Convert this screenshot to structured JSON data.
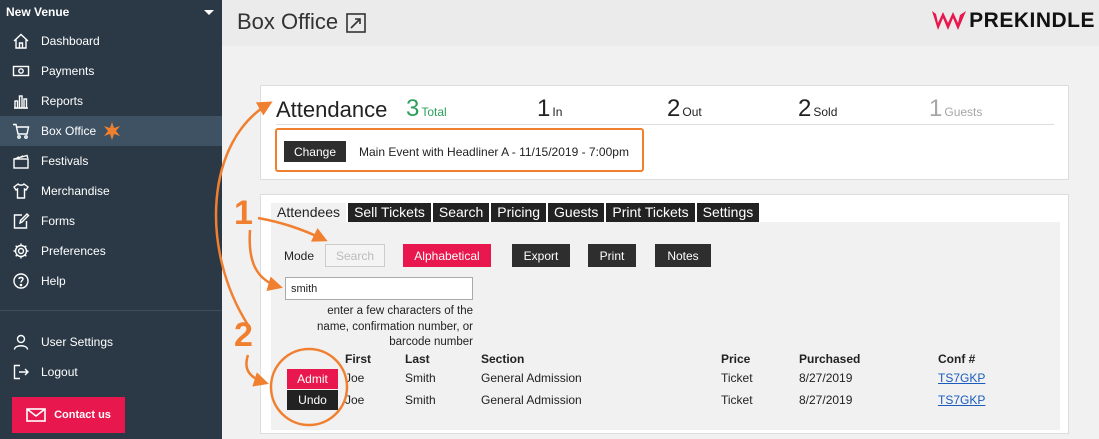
{
  "sidebar": {
    "venue": "New Venue",
    "items": [
      {
        "label": "Dashboard",
        "icon": "home-icon"
      },
      {
        "label": "Payments",
        "icon": "money-icon"
      },
      {
        "label": "Reports",
        "icon": "bar-chart-icon"
      },
      {
        "label": "Box Office",
        "icon": "cart-icon"
      },
      {
        "label": "Festivals",
        "icon": "film-icon"
      },
      {
        "label": "Merchandise",
        "icon": "shirt-icon"
      },
      {
        "label": "Forms",
        "icon": "edit-icon"
      },
      {
        "label": "Preferences",
        "icon": "gear-icon"
      },
      {
        "label": "Help",
        "icon": "help-icon"
      }
    ],
    "bottom": [
      {
        "label": "User Settings",
        "icon": "user-icon"
      },
      {
        "label": "Logout",
        "icon": "logout-icon"
      }
    ],
    "contact": "Contact us"
  },
  "header": {
    "title": "Box Office",
    "brand": "PREKINDLE"
  },
  "attendance": {
    "title": "Attendance",
    "stats": [
      {
        "n": "3",
        "label": "Total"
      },
      {
        "n": "1",
        "label": "In"
      },
      {
        "n": "2",
        "label": "Out"
      },
      {
        "n": "2",
        "label": "Sold"
      },
      {
        "n": "1",
        "label": "Guests"
      }
    ],
    "change": "Change",
    "event": "Main Event with Headliner A - 11/15/2019 - 7:00pm"
  },
  "tabs": [
    "Attendees",
    "Sell Tickets",
    "Search",
    "Pricing",
    "Guests",
    "Print Tickets",
    "Settings"
  ],
  "attendees": {
    "mode_label": "Mode",
    "buttons": {
      "search": "Search",
      "alphabetical": "Alphabetical",
      "export": "Export",
      "print": "Print",
      "notes": "Notes"
    },
    "search_value": "smith",
    "hint": "enter a few characters of the name, confirmation number, or barcode number",
    "columns": [
      "First",
      "Last",
      "Section",
      "Price",
      "Purchased",
      "Conf #"
    ],
    "rows": [
      {
        "action": "Admit",
        "first": "Joe",
        "last": "Smith",
        "section": "General Admission",
        "price": "Ticket",
        "purchased": "8/27/2019",
        "conf": "TS7GKP"
      },
      {
        "action": "Undo",
        "first": "Joe",
        "last": "Smith",
        "section": "General Admission",
        "price": "Ticket",
        "purchased": "8/27/2019",
        "conf": "TS7GKP"
      }
    ]
  },
  "annotations": {
    "step1": "1",
    "step2": "2",
    "color": "#f08030"
  },
  "colors": {
    "sidebar_bg": "#2b3946",
    "accent": "#e8174d",
    "total_green": "#2ca05a"
  }
}
